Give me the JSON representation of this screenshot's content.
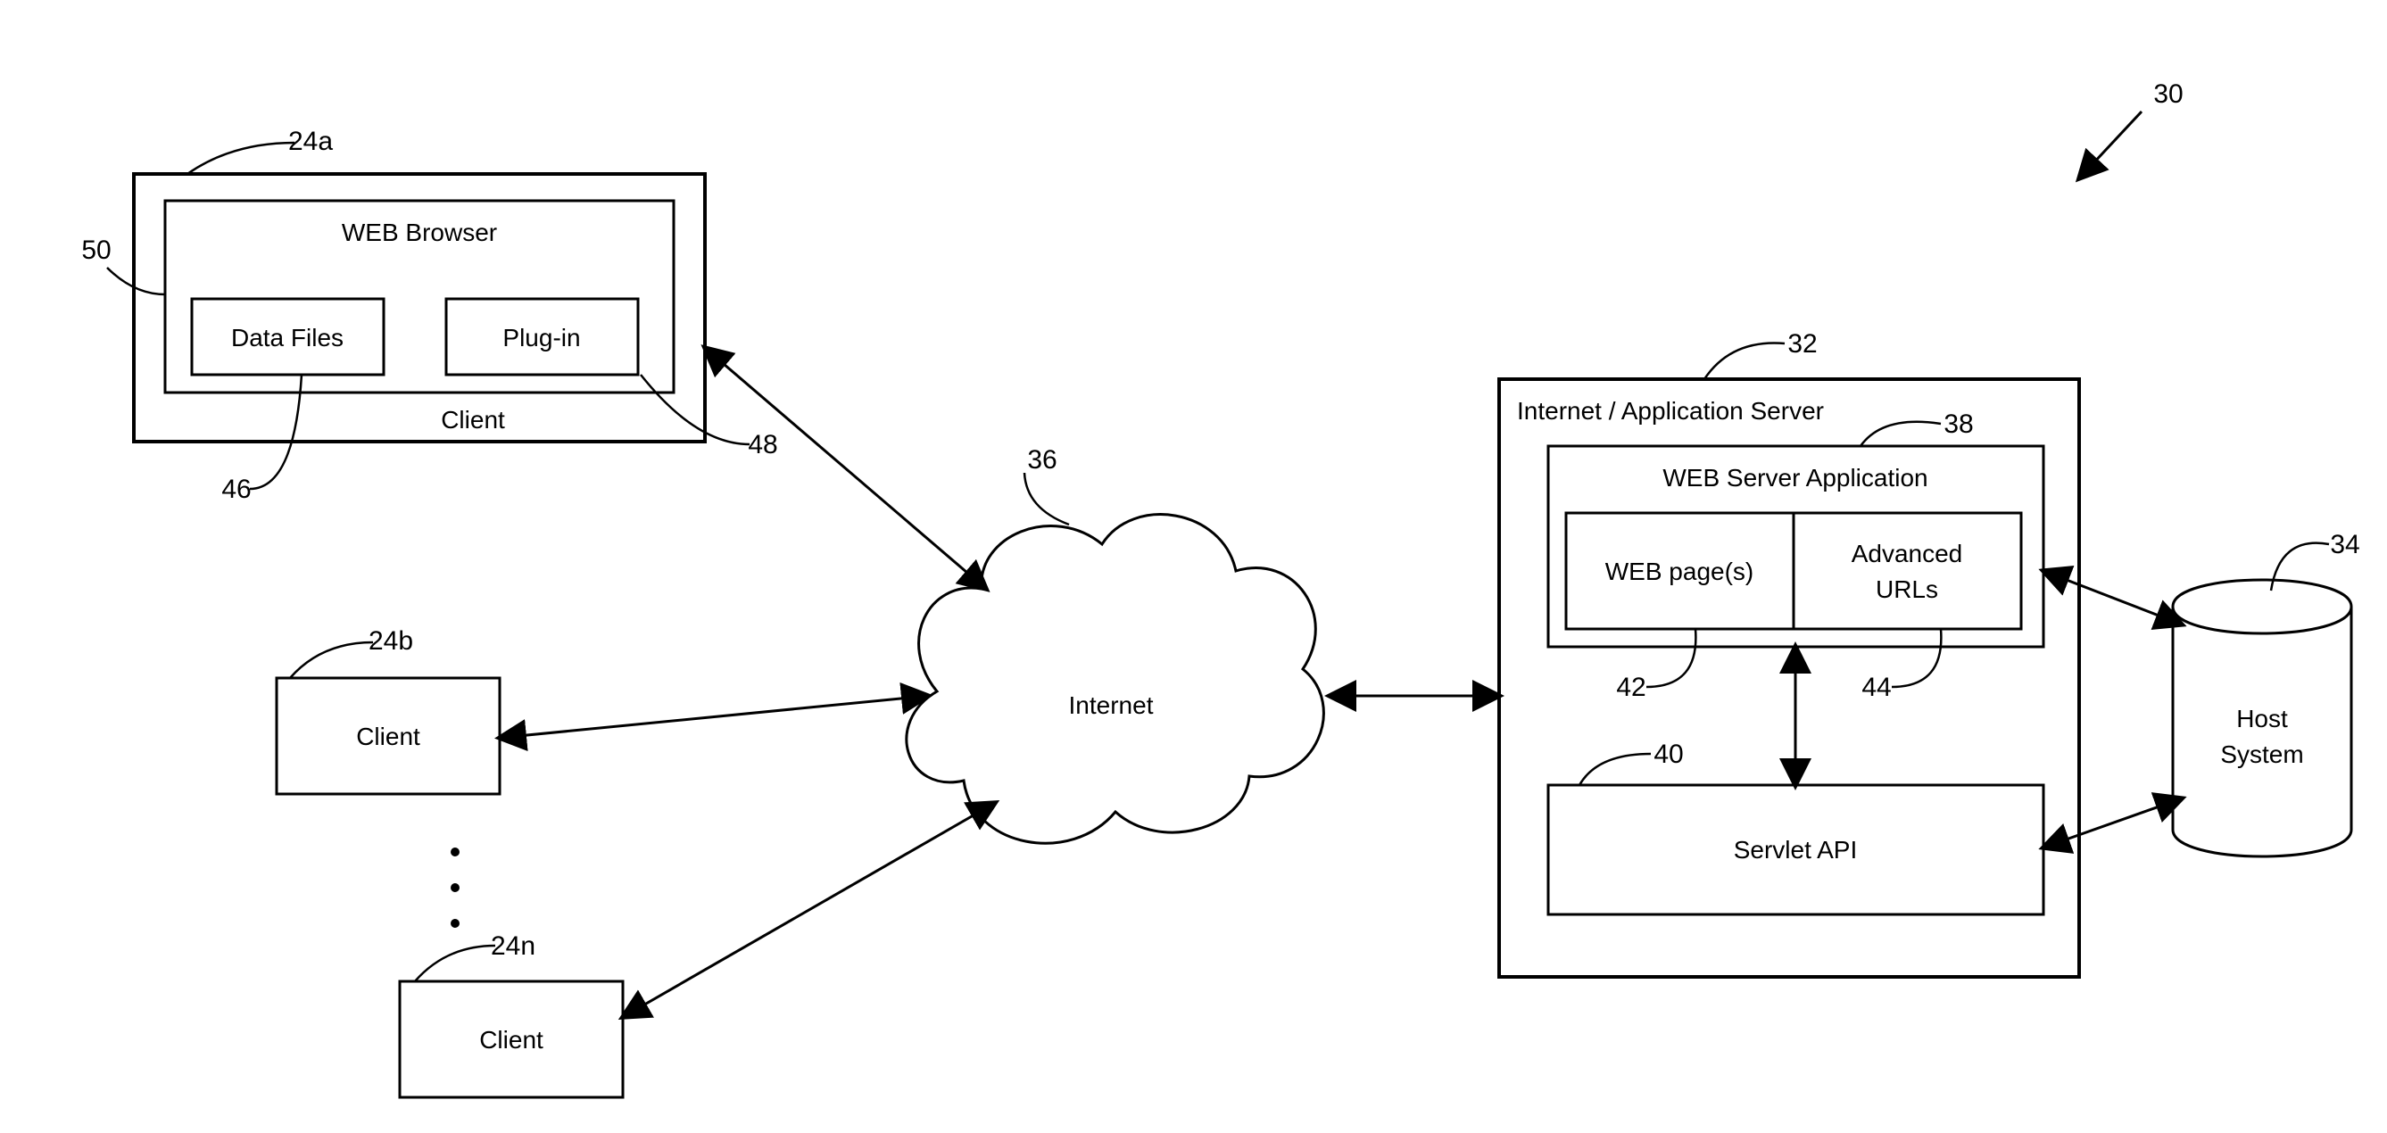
{
  "labels": {
    "client_a": "Client",
    "client_b": "Client",
    "client_n": "Client",
    "browser": "WEB Browser",
    "data_files": "Data Files",
    "plugin": "Plug-in",
    "internet": "Internet",
    "app_server": "Internet / Application Server",
    "web_server_app": "WEB Server Application",
    "web_pages": "WEB page(s)",
    "adv_urls1": "Advanced",
    "adv_urls2": "URLs",
    "servlet": "Servlet API",
    "host1": "Host",
    "host2": "System"
  },
  "refs": {
    "r30": "30",
    "r32": "32",
    "r34": "34",
    "r36": "36",
    "r38": "38",
    "r40": "40",
    "r42": "42",
    "r44": "44",
    "r46": "46",
    "r48": "48",
    "r50": "50",
    "r24a": "24a",
    "r24b": "24b",
    "r24n": "24n"
  }
}
